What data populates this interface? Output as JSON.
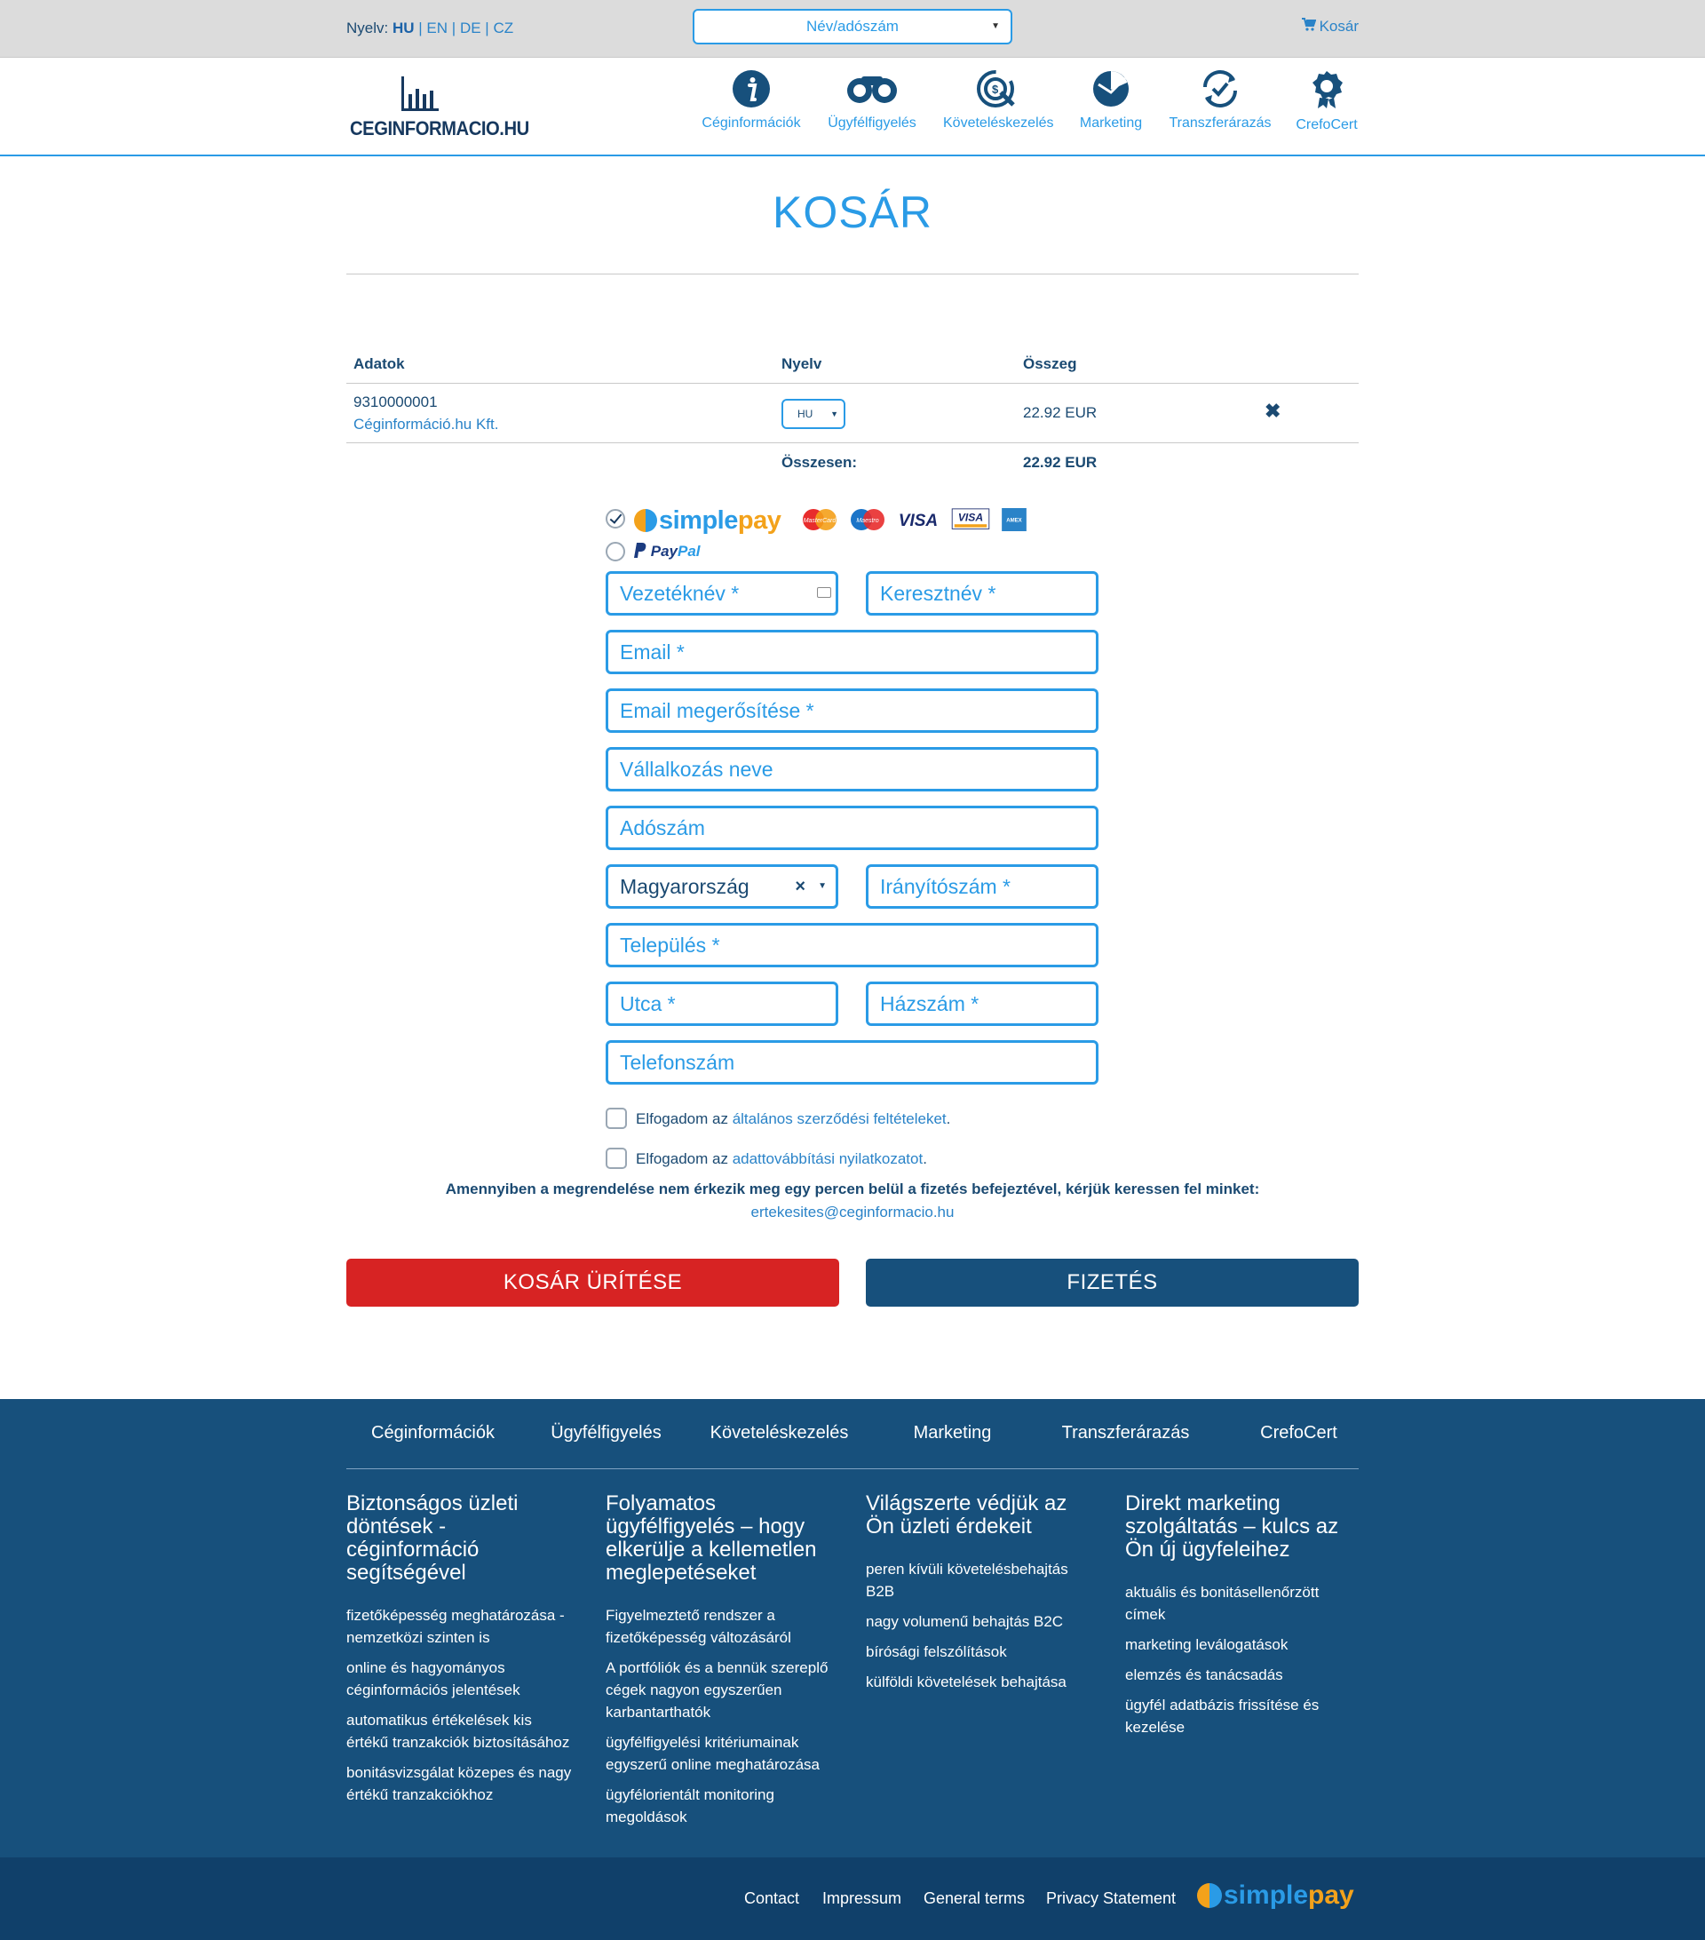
{
  "topbar": {
    "lang_label": "Nyelv:",
    "languages": [
      "HU",
      "EN",
      "DE",
      "CZ"
    ],
    "search_select": "Név/adószám",
    "cart_label": "Kosár"
  },
  "brand": {
    "name": "CEGINFORMACIO.HU"
  },
  "nav": [
    "Céginformációk",
    "Ügyfélfigyelés",
    "Követeléskezelés",
    "Marketing",
    "Transzferárazás",
    "CrefoCert"
  ],
  "page": {
    "title": "KOSÁR"
  },
  "table": {
    "headers": {
      "data": "Adatok",
      "language": "Nyelv",
      "amount": "Összeg"
    },
    "row": {
      "tax_id": "9310000001",
      "company": "Céginformáció.hu Kft.",
      "language": "HU",
      "amount": "22.92 EUR"
    },
    "total_label": "Összesen:",
    "total_value": "22.92 EUR"
  },
  "payment": {
    "simplepay_a": "simple",
    "simplepay_b": "pay",
    "paypal_a": "Pay",
    "paypal_b": "Pal",
    "cards": [
      "MasterCard",
      "Maestro",
      "VISA",
      "VISA",
      "AMEX"
    ]
  },
  "form": {
    "last_name": "Vezetéknév *",
    "first_name": "Keresztnév *",
    "email": "Email *",
    "email_confirm": "Email megerősítése *",
    "company": "Vállalkozás neve",
    "tax": "Adószám",
    "country": "Magyarország",
    "zip": "Irányítószám *",
    "city": "Település *",
    "street": "Utca *",
    "house": "Házszám *",
    "phone": "Telefonszám"
  },
  "consents": {
    "accept_prefix": "Elfogadom az",
    "terms_link": "általános szerződési feltételeket",
    "data_link": "adattovábbítási nyilatkozatot"
  },
  "notice": {
    "text": "Amennyiben a megrendelése nem érkezik meg egy percen belül a fizetés befejeztével, kérjük keressen fel minket:",
    "email": "ertekesites@ceginformacio.hu"
  },
  "buttons": {
    "empty_cart": "KOSÁR ÜRÍTÉSE",
    "pay": "FIZETÉS"
  },
  "footer": {
    "nav": [
      "Céginformációk",
      "Ügyfélfigyelés",
      "Követeléskezelés",
      "Marketing",
      "Transzferárazás",
      "CrefoCert"
    ],
    "columns": [
      {
        "title": "Biztonságos üzleti döntések - céginformáció segítségével",
        "items": [
          "fizetőképesség meghatározása - nemzetközi szinten is",
          "online és hagyományos céginformációs jelentések",
          "automatikus értékelések kis értékű tranzakciók biztosításához",
          "bonitásvizsgálat közepes és nagy értékű tranzakciókhoz"
        ]
      },
      {
        "title": "Folyamatos ügyfélfigyelés – hogy elkerülje a kellemetlen meglepetéseket",
        "items": [
          "Figyelmeztető rendszer a fizetőképesség változásáról",
          "A portfóliók és a bennük szereplő cégek nagyon egyszerűen karbantarthatók",
          "ügyfélfigyelési kritériumainak egyszerű online meghatározása",
          "ügyfélorientált monitoring megoldások"
        ]
      },
      {
        "title": "Világszerte védjük az Ön üzleti érdekeit",
        "items": [
          "peren kívüli követelésbehajtás B2B",
          "nagy volumenű behajtás B2C",
          "bírósági felszólítások",
          "külföldi követelések behajtása"
        ]
      },
      {
        "title": "Direkt marketing szolgáltatás – kulcs az Ön új ügyfeleihez",
        "items": [
          "aktuális és bonitásellenőrzött címek",
          "marketing leválogatások",
          "elemzés és tanácsadás",
          "ügyfél adatbázis frissítése és kezelése"
        ]
      }
    ],
    "bottom_links": [
      "Contact",
      "Impressum",
      "General terms",
      "Privacy Statement"
    ],
    "simplepay_a": "simple",
    "simplepay_b": "pay"
  }
}
